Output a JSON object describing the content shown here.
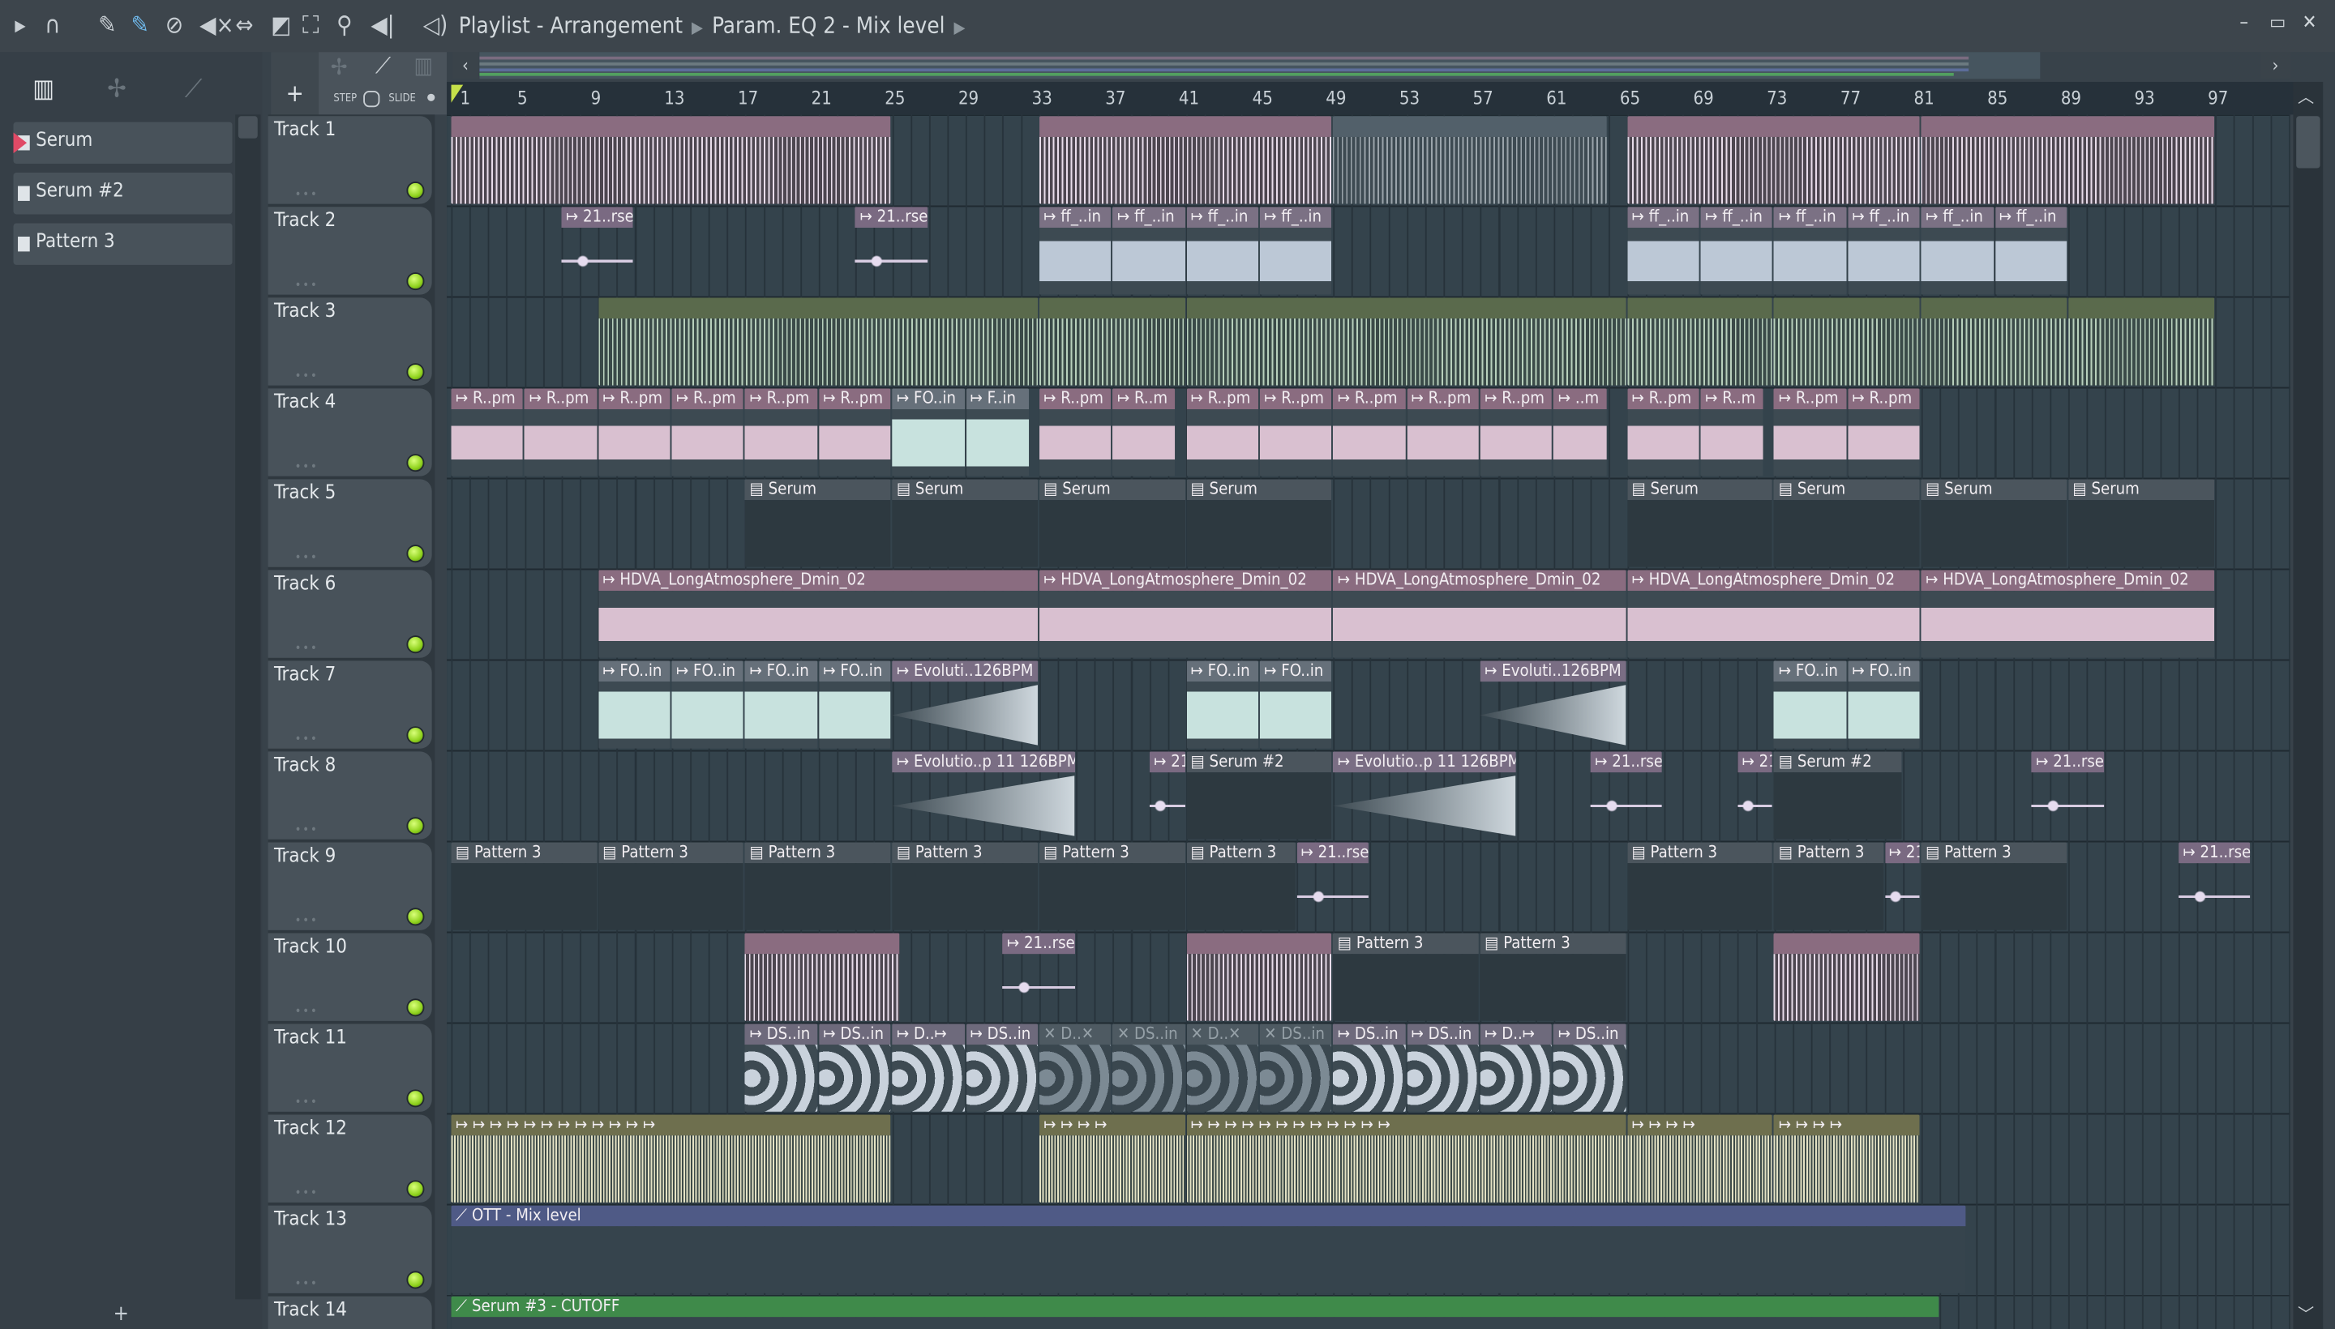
{
  "toolbar": {
    "icons": [
      "play-arrow-icon",
      "magnet-icon",
      "pencil-icon",
      "paint-icon",
      "delete-icon",
      "mute-icon",
      "slip-icon",
      "slice-icon",
      "select-icon",
      "zoom-icon",
      "playback-icon"
    ],
    "speaker_icon": "speaker-icon"
  },
  "breadcrumb": {
    "items": [
      "Playlist - Arrangement",
      "Param. EQ 2 - Mix level"
    ]
  },
  "browser": {
    "items": [
      {
        "label": "Serum"
      },
      {
        "label": "Serum #2"
      },
      {
        "label": "Pattern 3"
      }
    ],
    "add_label": "+"
  },
  "tools": {
    "add_label": "+",
    "step_label": "STEP",
    "slide_label": "SLIDE"
  },
  "ruler": {
    "bars": [
      "1",
      "5",
      "9",
      "13",
      "17",
      "21",
      "25",
      "29",
      "33",
      "37",
      "41",
      "45",
      "49",
      "53",
      "57",
      "61",
      "65",
      "69",
      "73",
      "77",
      "81",
      "85",
      "89",
      "93",
      "97"
    ]
  },
  "tracks": [
    "Track 1",
    "Track 2",
    "Track 3",
    "Track 4",
    "Track 5",
    "Track 6",
    "Track 7",
    "Track 8",
    "Track 9",
    "Track 10",
    "Track 11",
    "Track 12",
    "Track 13",
    "Track 14"
  ],
  "clips": [
    {
      "t": 1,
      "s": 1,
      "l": 24,
      "label": "",
      "type": "audio-pink"
    },
    {
      "t": 1,
      "s": 33,
      "l": 16,
      "label": "",
      "type": "audio-pink"
    },
    {
      "t": 1,
      "s": 49,
      "l": 15,
      "label": "",
      "type": "grey"
    },
    {
      "t": 1,
      "s": 65,
      "l": 16,
      "label": "",
      "type": "audio-pink"
    },
    {
      "t": 1,
      "s": 81,
      "l": 16,
      "label": "",
      "type": "audio-pink"
    },
    {
      "t": 2,
      "s": 7,
      "l": 4,
      "label": "↦ 21..rse",
      "type": "shot"
    },
    {
      "t": 2,
      "s": 23,
      "l": 4,
      "label": "↦ 21..rse",
      "type": "shot"
    },
    {
      "t": 2,
      "s": 33,
      "l": 4,
      "label": "↦ ff_..in",
      "type": "audio-blue"
    },
    {
      "t": 2,
      "s": 37,
      "l": 4,
      "label": "↦ ff_..in",
      "type": "audio-blue"
    },
    {
      "t": 2,
      "s": 41,
      "l": 4,
      "label": "↦ ff_..in",
      "type": "audio-blue"
    },
    {
      "t": 2,
      "s": 45,
      "l": 4,
      "label": "↦ ff_..in",
      "type": "audio-blue"
    },
    {
      "t": 2,
      "s": 65,
      "l": 4,
      "label": "↦ ff_..in",
      "type": "audio-blue"
    },
    {
      "t": 2,
      "s": 69,
      "l": 4,
      "label": "↦ ff_..in",
      "type": "audio-blue"
    },
    {
      "t": 2,
      "s": 73,
      "l": 4,
      "label": "↦ ff_..in",
      "type": "audio-blue"
    },
    {
      "t": 2,
      "s": 77,
      "l": 4,
      "label": "↦ ff_..in",
      "type": "audio-blue"
    },
    {
      "t": 2,
      "s": 81,
      "l": 4,
      "label": "↦ ff_..in",
      "type": "audio-blue"
    },
    {
      "t": 2,
      "s": 85,
      "l": 4,
      "label": "↦ ff_..in",
      "type": "audio-blue"
    },
    {
      "t": 3,
      "s": 9,
      "l": 24,
      "label": "",
      "type": "audio-green"
    },
    {
      "t": 3,
      "s": 33,
      "l": 8,
      "label": "",
      "type": "audio-green"
    },
    {
      "t": 3,
      "s": 41,
      "l": 24,
      "label": "",
      "type": "audio-green"
    },
    {
      "t": 3,
      "s": 65,
      "l": 8,
      "label": "",
      "type": "audio-green"
    },
    {
      "t": 3,
      "s": 73,
      "l": 8,
      "label": "",
      "type": "audio-green"
    },
    {
      "t": 3,
      "s": 81,
      "l": 8,
      "label": "",
      "type": "audio-green"
    },
    {
      "t": 3,
      "s": 89,
      "l": 8,
      "label": "",
      "type": "audio-green"
    },
    {
      "t": 4,
      "s": 1,
      "l": 4,
      "label": "↦ R..pm",
      "type": "audio-pinkw"
    },
    {
      "t": 4,
      "s": 5,
      "l": 4,
      "label": "↦ R..pm",
      "type": "audio-pinkw"
    },
    {
      "t": 4,
      "s": 9,
      "l": 4,
      "label": "↦ R..pm",
      "type": "audio-pinkw"
    },
    {
      "t": 4,
      "s": 13,
      "l": 4,
      "label": "↦ R..pm",
      "type": "audio-pinkw"
    },
    {
      "t": 4,
      "s": 17,
      "l": 4,
      "label": "↦ R..pm",
      "type": "audio-pinkw"
    },
    {
      "t": 4,
      "s": 21,
      "l": 4,
      "label": "↦ R..pm",
      "type": "audio-pinkw"
    },
    {
      "t": 4,
      "s": 25,
      "l": 4,
      "label": "↦ FO..in",
      "type": "audio-mint"
    },
    {
      "t": 4,
      "s": 29,
      "l": 3.5,
      "label": "↦ F..in",
      "type": "audio-mint"
    },
    {
      "t": 4,
      "s": 33,
      "l": 4,
      "label": "↦ R..pm",
      "type": "audio-pinkw"
    },
    {
      "t": 4,
      "s": 37,
      "l": 3.5,
      "label": "↦ R..m",
      "type": "audio-pinkw"
    },
    {
      "t": 4,
      "s": 41,
      "l": 4,
      "label": "↦ R..pm",
      "type": "audio-pinkw"
    },
    {
      "t": 4,
      "s": 45,
      "l": 4,
      "label": "↦ R..pm",
      "type": "audio-pinkw"
    },
    {
      "t": 4,
      "s": 49,
      "l": 4,
      "label": "↦ R..pm",
      "type": "audio-pinkw"
    },
    {
      "t": 4,
      "s": 53,
      "l": 4,
      "label": "↦ R..pm",
      "type": "audio-pinkw"
    },
    {
      "t": 4,
      "s": 57,
      "l": 4,
      "label": "↦ R..pm",
      "type": "audio-pinkw"
    },
    {
      "t": 4,
      "s": 61,
      "l": 3,
      "label": "↦ ..m",
      "type": "audio-pinkw"
    },
    {
      "t": 4,
      "s": 65,
      "l": 4,
      "label": "↦ R..pm",
      "type": "audio-pinkw"
    },
    {
      "t": 4,
      "s": 69,
      "l": 3.5,
      "label": "↦ R..m",
      "type": "audio-pinkw"
    },
    {
      "t": 4,
      "s": 73,
      "l": 4,
      "label": "↦ R..pm",
      "type": "audio-pinkw"
    },
    {
      "t": 4,
      "s": 77,
      "l": 4,
      "label": "↦ R..pm",
      "type": "audio-pinkw"
    },
    {
      "t": 5,
      "s": 17,
      "l": 8,
      "label": "▤ Serum",
      "type": "pattern"
    },
    {
      "t": 5,
      "s": 25,
      "l": 8,
      "label": "▤ Serum",
      "type": "pattern"
    },
    {
      "t": 5,
      "s": 33,
      "l": 8,
      "label": "▤ Serum",
      "type": "pattern"
    },
    {
      "t": 5,
      "s": 41,
      "l": 8,
      "label": "▤ Serum",
      "type": "pattern"
    },
    {
      "t": 5,
      "s": 65,
      "l": 8,
      "label": "▤ Serum",
      "type": "pattern"
    },
    {
      "t": 5,
      "s": 73,
      "l": 8,
      "label": "▤ Serum",
      "type": "pattern"
    },
    {
      "t": 5,
      "s": 81,
      "l": 8,
      "label": "▤ Serum",
      "type": "pattern"
    },
    {
      "t": 5,
      "s": 89,
      "l": 8,
      "label": "▤ Serum",
      "type": "pattern"
    },
    {
      "t": 6,
      "s": 9,
      "l": 24,
      "label": "↦ HDVA_LongAtmosphere_Dmin_02",
      "type": "audio-pinkw"
    },
    {
      "t": 6,
      "s": 33,
      "l": 16,
      "label": "↦ HDVA_LongAtmosphere_Dmin_02",
      "type": "audio-pinkw"
    },
    {
      "t": 6,
      "s": 49,
      "l": 16,
      "label": "↦ HDVA_LongAtmosphere_Dmin_02",
      "type": "audio-pinkw"
    },
    {
      "t": 6,
      "s": 65,
      "l": 16,
      "label": "↦ HDVA_LongAtmosphere_Dmin_02",
      "type": "audio-pinkw"
    },
    {
      "t": 6,
      "s": 81,
      "l": 16,
      "label": "↦ HDVA_LongAtmosphere_Dmin_02",
      "type": "audio-pinkw"
    },
    {
      "t": 7,
      "s": 9,
      "l": 4,
      "label": "↦ FO..in",
      "type": "audio-mint"
    },
    {
      "t": 7,
      "s": 13,
      "l": 4,
      "label": "↦ FO..in",
      "type": "audio-mint"
    },
    {
      "t": 7,
      "s": 17,
      "l": 4,
      "label": "↦ FO..in",
      "type": "audio-mint"
    },
    {
      "t": 7,
      "s": 21,
      "l": 4,
      "label": "↦ FO..in",
      "type": "audio-mint"
    },
    {
      "t": 7,
      "s": 25,
      "l": 8,
      "label": "↦ Evoluti..126BPM",
      "type": "audio-evo"
    },
    {
      "t": 7,
      "s": 41,
      "l": 4,
      "label": "↦ FO..in",
      "type": "audio-mint"
    },
    {
      "t": 7,
      "s": 45,
      "l": 4,
      "label": "↦ FO..in",
      "type": "audio-mint"
    },
    {
      "t": 7,
      "s": 57,
      "l": 8,
      "label": "↦ Evoluti..126BPM",
      "type": "audio-evo"
    },
    {
      "t": 7,
      "s": 73,
      "l": 4,
      "label": "↦ FO..in",
      "type": "audio-mint"
    },
    {
      "t": 7,
      "s": 77,
      "l": 4,
      "label": "↦ FO..in",
      "type": "audio-mint"
    },
    {
      "t": 8,
      "s": 25,
      "l": 10,
      "label": "↦ Evolutio..p 11 126BPM",
      "type": "audio-evo"
    },
    {
      "t": 8,
      "s": 39,
      "l": 2,
      "label": "↦ 21",
      "type": "shot"
    },
    {
      "t": 8,
      "s": 41,
      "l": 8,
      "label": "▤ Serum #2",
      "type": "pattern"
    },
    {
      "t": 8,
      "s": 49,
      "l": 10,
      "label": "↦ Evolutio..p 11 126BPM",
      "type": "audio-evo"
    },
    {
      "t": 8,
      "s": 63,
      "l": 4,
      "label": "↦ 21..rse",
      "type": "shot"
    },
    {
      "t": 8,
      "s": 71,
      "l": 2,
      "label": "↦ 21",
      "type": "shot"
    },
    {
      "t": 8,
      "s": 73,
      "l": 7,
      "label": "▤ Serum #2",
      "type": "pattern"
    },
    {
      "t": 8,
      "s": 87,
      "l": 4,
      "label": "↦ 21..rse",
      "type": "shot"
    },
    {
      "t": 9,
      "s": 1,
      "l": 8,
      "label": "▤ Pattern 3",
      "type": "pattern"
    },
    {
      "t": 9,
      "s": 9,
      "l": 8,
      "label": "▤ Pattern 3",
      "type": "pattern"
    },
    {
      "t": 9,
      "s": 17,
      "l": 8,
      "label": "▤ Pattern 3",
      "type": "pattern"
    },
    {
      "t": 9,
      "s": 25,
      "l": 8,
      "label": "▤ Pattern 3",
      "type": "pattern"
    },
    {
      "t": 9,
      "s": 33,
      "l": 8,
      "label": "▤ Pattern 3",
      "type": "pattern"
    },
    {
      "t": 9,
      "s": 41,
      "l": 6,
      "label": "▤ Pattern 3",
      "type": "pattern"
    },
    {
      "t": 9,
      "s": 47,
      "l": 4,
      "label": "↦ 21..rse",
      "type": "shot"
    },
    {
      "t": 9,
      "s": 65,
      "l": 8,
      "label": "▤ Pattern 3",
      "type": "pattern"
    },
    {
      "t": 9,
      "s": 73,
      "l": 6,
      "label": "▤ Pattern 3",
      "type": "pattern"
    },
    {
      "t": 9,
      "s": 79,
      "l": 2,
      "label": "↦ 21",
      "type": "shot"
    },
    {
      "t": 9,
      "s": 81,
      "l": 8,
      "label": "▤ Pattern 3",
      "type": "pattern"
    },
    {
      "t": 9,
      "s": 95,
      "l": 4,
      "label": "↦ 21..rse",
      "type": "shot"
    },
    {
      "t": 10,
      "s": 17,
      "l": 8.5,
      "label": "",
      "type": "audio-pink"
    },
    {
      "t": 10,
      "s": 31,
      "l": 4,
      "label": "↦ 21..rse",
      "type": "shot"
    },
    {
      "t": 10,
      "s": 41,
      "l": 8,
      "label": "",
      "type": "audio-pink"
    },
    {
      "t": 10,
      "s": 49,
      "l": 8,
      "label": "▤ Pattern 3",
      "type": "pattern"
    },
    {
      "t": 10,
      "s": 57,
      "l": 8,
      "label": "▤ Pattern 3",
      "type": "pattern"
    },
    {
      "t": 10,
      "s": 73,
      "l": 8,
      "label": "",
      "type": "audio-pink"
    },
    {
      "t": 11,
      "s": 17,
      "l": 4,
      "label": "↦ DS..in",
      "type": "ds"
    },
    {
      "t": 11,
      "s": 21,
      "l": 4,
      "label": "↦ DS..in",
      "type": "ds"
    },
    {
      "t": 11,
      "s": 25,
      "l": 4,
      "label": "↦ D..↦",
      "type": "ds"
    },
    {
      "t": 11,
      "s": 29,
      "l": 4,
      "label": "↦ DS..in",
      "type": "ds"
    },
    {
      "t": 11,
      "s": 33,
      "l": 4,
      "label": "✕ D..✕",
      "type": "muted"
    },
    {
      "t": 11,
      "s": 37,
      "l": 4,
      "label": "✕ DS..in",
      "type": "muted"
    },
    {
      "t": 11,
      "s": 41,
      "l": 4,
      "label": "✕ D..✕",
      "type": "muted"
    },
    {
      "t": 11,
      "s": 45,
      "l": 4,
      "label": "✕ DS..in",
      "type": "muted"
    },
    {
      "t": 11,
      "s": 49,
      "l": 4,
      "label": "↦ DS..in",
      "type": "ds"
    },
    {
      "t": 11,
      "s": 53,
      "l": 4,
      "label": "↦ DS..in",
      "type": "ds"
    },
    {
      "t": 11,
      "s": 57,
      "l": 4,
      "label": "↦ D..↦",
      "type": "ds"
    },
    {
      "t": 11,
      "s": 61,
      "l": 4,
      "label": "↦ DS..in",
      "type": "ds"
    },
    {
      "t": 12,
      "s": 1,
      "l": 24,
      "label": "↦   ↦   ↦   ↦   ↦   ↦   ↦   ↦   ↦   ↦   ↦   ↦",
      "type": "olive"
    },
    {
      "t": 12,
      "s": 33,
      "l": 8,
      "label": "↦   ↦   ↦   ↦",
      "type": "olive"
    },
    {
      "t": 12,
      "s": 41,
      "l": 24,
      "label": "↦   ↦   ↦   ↦   ↦   ↦   ↦   ↦   ↦   ↦   ↦   ↦",
      "type": "olive"
    },
    {
      "t": 12,
      "s": 65,
      "l": 8,
      "label": "↦   ↦   ↦   ↦",
      "type": "olive"
    },
    {
      "t": 12,
      "s": 73,
      "l": 8,
      "label": "↦   ↦   ↦   ↦",
      "type": "olive"
    },
    {
      "t": 13,
      "s": 1,
      "l": 82.5,
      "label": "⟋ OTT - Mix level",
      "type": "auto-blue"
    },
    {
      "t": 14,
      "s": 1,
      "l": 81,
      "label": "⟋ Serum #3 - CUTOFF",
      "type": "auto-green"
    }
  ]
}
